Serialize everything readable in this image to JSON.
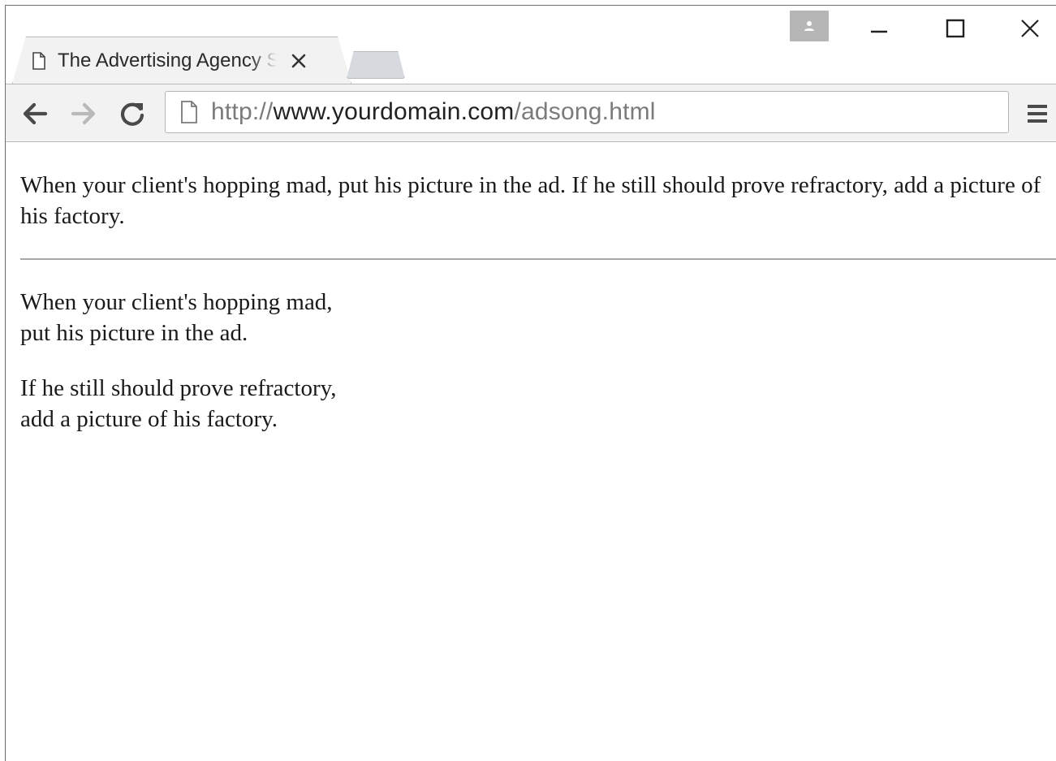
{
  "browser": {
    "tab": {
      "title": "The Advertising Agency Song",
      "icon": "page-icon",
      "close_icon": "close-icon"
    },
    "new_tab_icon": "new-tab-icon",
    "profile_icon": "person-icon",
    "window_controls": {
      "minimize_icon": "minimize-icon",
      "maximize_icon": "maximize-icon",
      "close_icon": "close-icon"
    },
    "toolbar": {
      "back_icon": "back-arrow-icon",
      "forward_icon": "forward-arrow-icon",
      "reload_icon": "reload-icon",
      "menu_icon": "hamburger-menu-icon"
    },
    "address": {
      "scheme": "http://",
      "host": "www.yourdomain.com",
      "path": "/adsong.html"
    }
  },
  "page": {
    "paragraph": "When your client's hopping mad, put his picture in the ad. If he still should prove refractory, add a picture of his factory.",
    "stanza1": {
      "line1": "When your client's hopping mad,",
      "line2": "put his picture in the ad."
    },
    "stanza2": {
      "line1": "If he still should prove refractory,",
      "line2": "add a picture of his factory."
    }
  }
}
